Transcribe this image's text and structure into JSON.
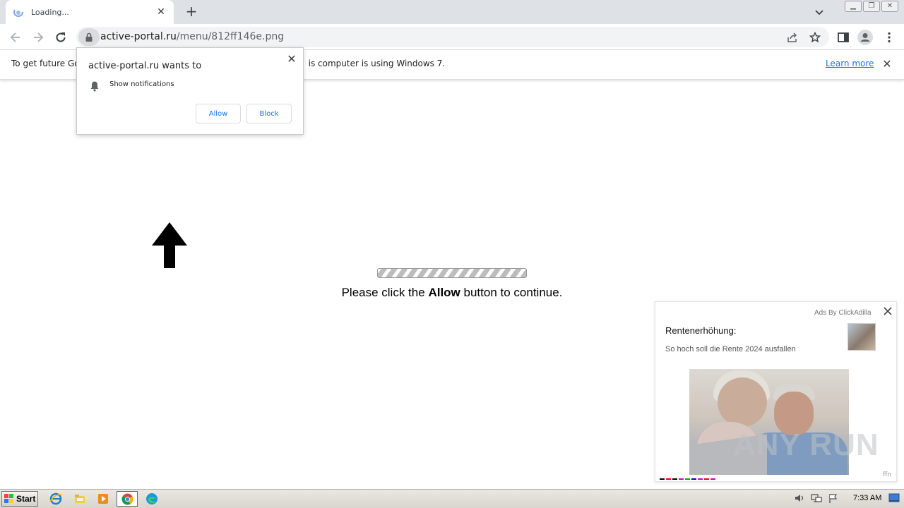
{
  "browser": {
    "tab_title": "Loading...",
    "url_domain": "active-portal.ru",
    "url_path": "/menu/812ff146e.png"
  },
  "infobar": {
    "text_before": "To get future Go",
    "text_after": "is computer is using Windows 7.",
    "learn_more": "Learn more"
  },
  "permission_popup": {
    "title": "active-portal.ru wants to",
    "permission": "Show notifications",
    "allow_label": "Allow",
    "block_label": "Block"
  },
  "page": {
    "message_before": "Please click the",
    "message_bold": "Allow",
    "message_after": "button to continue."
  },
  "ad": {
    "by": "Ads By ClickAdilla",
    "title": "Rentenerhöhung:",
    "subtitle": "So hoch soll die Rente 2024 ausfallen",
    "footer": "ffn",
    "watermark": "ANY RUN"
  },
  "taskbar": {
    "start_label": "Start",
    "clock": "7:33 AM"
  },
  "icons": {
    "lock": "lock-icon",
    "bell": "bell-icon",
    "arrow": "up-arrow-icon"
  },
  "colors": {
    "link": "#1a73e8",
    "tab_strip": "#dee1e6"
  }
}
